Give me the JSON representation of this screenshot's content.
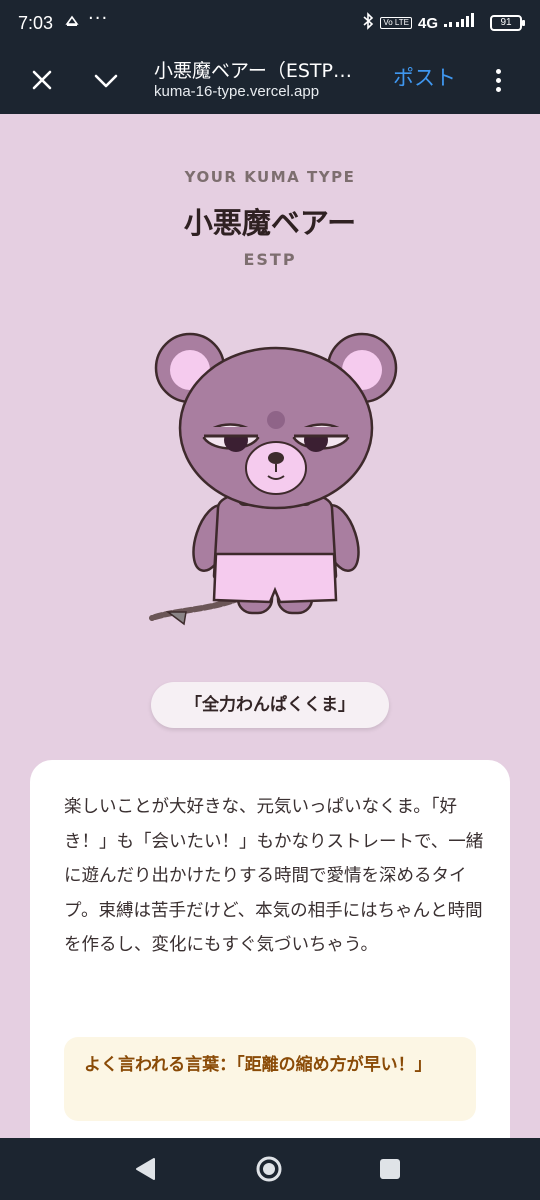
{
  "status_bar": {
    "time": "7:03",
    "more": "···",
    "volte": "Vo LTE",
    "network": "4G",
    "battery": "91"
  },
  "browser": {
    "title": "小悪魔ベアー（ESTP…",
    "url": "kuma-16-type.vercel.app",
    "post_label": "ポスト"
  },
  "result": {
    "eyebrow": "YOUR KUMA TYPE",
    "title": "小悪魔ベアー",
    "code": "ESTP",
    "tagline": "「全力わんぱくくま」",
    "description": "楽しいことが大好きな、元気いっぱいなくま。「好き！」も「会いたい！」もかなりストレートで、一緒に遊んだり出かけたりする時間で愛情を深めるタイプ。束縛は苦手だけど、本気の相手にはちゃんと時間を作るし、変化にもすぐ気づいちゃう。",
    "quote": "よく言われる言葉：「距離の縮め方が早い！」"
  },
  "icons": {
    "status_app": "cloud-app-icon",
    "bluetooth": "bluetooth-icon",
    "close": "close-icon",
    "chevron": "chevron-down-icon",
    "menu": "more-vert-icon",
    "nav_back": "back-triangle-icon",
    "nav_home": "home-circle-icon",
    "nav_recent": "recents-square-icon"
  },
  "colors": {
    "page_background": "#e5cfe1",
    "chrome_background": "#1c2530",
    "post_accent": "#3f97ef",
    "quote_text": "#8a4b07",
    "quote_background": "#fcf6e4"
  }
}
